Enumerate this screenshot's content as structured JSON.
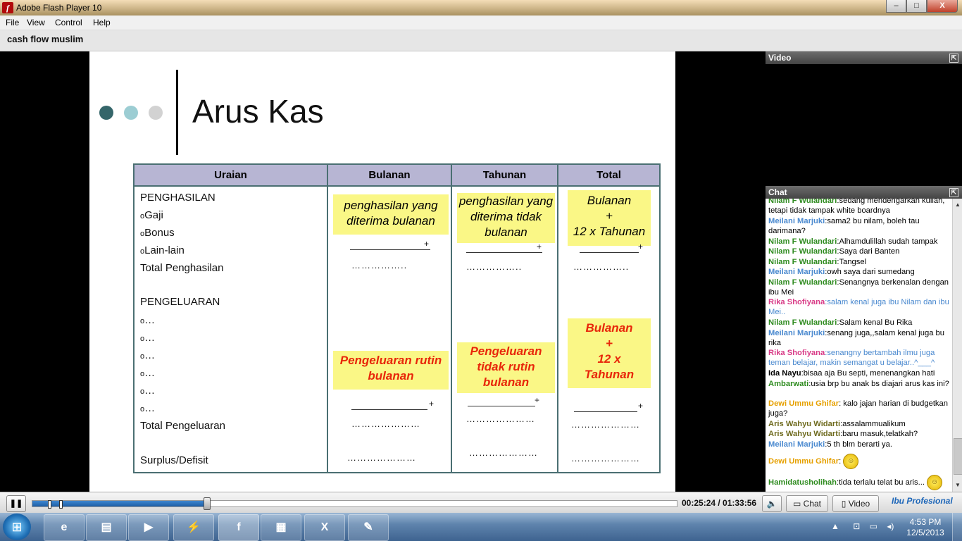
{
  "window": {
    "title": "Adobe Flash Player 10",
    "controls": [
      "–",
      "□",
      "X"
    ]
  },
  "menu": [
    "File",
    "View",
    "Control",
    "Help"
  ],
  "header": {
    "room_title": "cash flow muslim"
  },
  "slide": {
    "title": "Arus Kas",
    "dot_colors": [
      "#35666a",
      "#9ccdd3",
      "#d2d2d2"
    ],
    "columns": [
      "Uraian",
      "Bulanan",
      "Tahunan",
      "Total"
    ],
    "uraian": {
      "penghasilan": "PENGHASILAN",
      "gaji": "Gaji",
      "bonus": "Bonus",
      "lainlain": "Lain-lain",
      "total_penghasilan": "Total Penghasilan",
      "pengeluaran": "PENGELUARAN",
      "items": [
        "…",
        "…",
        "…",
        "…",
        "…",
        "…"
      ],
      "total_pengeluaran": "Total Pengeluaran",
      "surplus": "Surplus/Defisit"
    },
    "bulanan": {
      "penghasilan_note": "penghasilan yang diterima bulanan",
      "pengeluaran_note": "Pengeluaran rutin bulanan"
    },
    "tahunan": {
      "penghasilan_note": "penghasilan yang diterima tidak bulanan",
      "pengeluaran_note": "Pengeluaran tidak rutin bulanan"
    },
    "total": {
      "penghasilan_lines": [
        "Bulanan",
        "+",
        "12 x Tahunan"
      ],
      "pengeluaran_lines": [
        "Bulanan",
        "+",
        "12 x",
        "Tahunan"
      ]
    },
    "plus": "+",
    "dots_short": "……………..",
    "dots_long": "…………………"
  },
  "panels": {
    "video": "Video",
    "chat": "Chat",
    "expand_icon": "⇱"
  },
  "chat": [
    {
      "name": "Nilam F Wulandari",
      "color": "green",
      "text": "sedang mendengarkan kuliah, tetapi tidak tampak white boardnya"
    },
    {
      "name": "Meilani Marjuki",
      "color": "blue",
      "text": "sama2 bu nilam, boleh tau darimana?"
    },
    {
      "name": "Nilam F Wulandari",
      "color": "green",
      "text": "Alhamdulillah sudah tampak"
    },
    {
      "name": "Nilam F Wulandari",
      "color": "green",
      "text": "Saya dari Banten"
    },
    {
      "name": "Nilam F Wulandari",
      "color": "green",
      "text": "Tangsel"
    },
    {
      "name": "Meilani Marjuki",
      "color": "blue",
      "text": "owh saya dari sumedang"
    },
    {
      "name": "Nilam F Wulandari",
      "color": "green",
      "text": "Senangnya berkenalan dengan ibu Mei"
    },
    {
      "name": "Rika Shofiyana",
      "color": "pink",
      "text": "salam kenal juga ibu Nilam dan ibu Mei.."
    },
    {
      "name": "Nilam F Wulandari",
      "color": "green",
      "text": "Salam kenal Bu Rika"
    },
    {
      "name": "Meilani Marjuki",
      "color": "blue",
      "text": "senang juga,,salam kenal juga bu rika"
    },
    {
      "name": "Rika Shofiyana",
      "color": "pink",
      "text": "senangny bertambah ilmu juga teman belajar, makin semangat u belajar..^___^"
    },
    {
      "name": "Ida Nayu",
      "color": "black",
      "text": "bisaa aja Bu septi, menenangkan hati"
    },
    {
      "name": "Ambarwati",
      "color": "green",
      "text": "usia brp bu anak bs diajari arus kas ini?"
    },
    {
      "name": "Dewi Ummu Ghifar",
      "color": "orange",
      "text": " kalo jajan harian di budgetkan juga?"
    },
    {
      "name": "Aris Wahyu Widarti",
      "color": "olive",
      "text": "assalammualikum"
    },
    {
      "name": "Aris Wahyu Widarti",
      "color": "olive",
      "text": "baru masuk,telatkah?"
    },
    {
      "name": "Meilani Marjuki",
      "color": "blue",
      "text": "5 th blm berarti ya."
    },
    {
      "name": "Dewi Ummu Ghifar",
      "color": "orange",
      "text": ""
    },
    {
      "name": "Hamidatusholihah",
      "color": "green",
      "text": "tida terlalu telat bu aris..."
    }
  ],
  "player": {
    "time": "00:25:24 / 01:33:56",
    "progress": 0.27,
    "chat_btn": "Chat",
    "video_btn": "Video",
    "brand": "Ibu Profesional",
    "pause_icon": "pause-icon"
  },
  "taskbar": {
    "time": "4:53 PM",
    "date": "12/5/2013",
    "items": [
      "IE",
      "Folder",
      "Media",
      "Winamp",
      "Flash",
      "Presentation",
      "Excel",
      "Paint"
    ]
  }
}
